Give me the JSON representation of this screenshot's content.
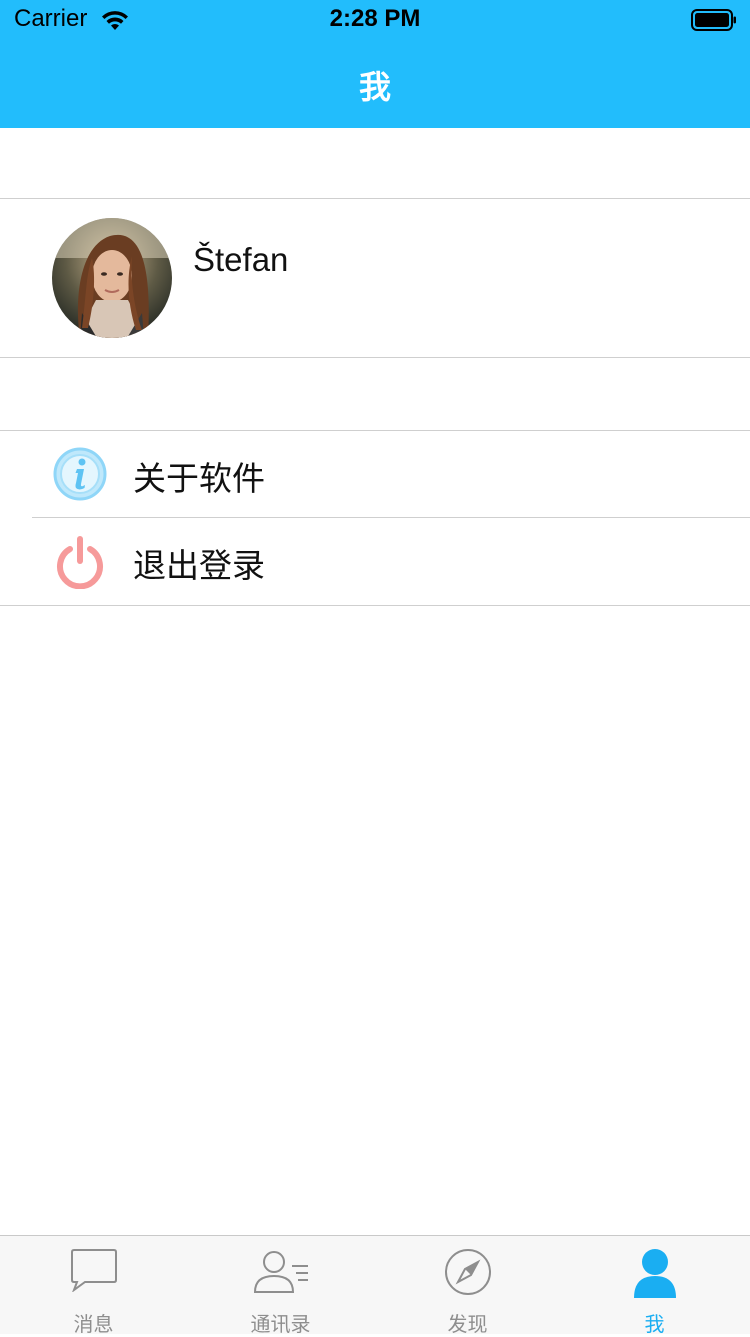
{
  "status_bar": {
    "carrier": "Carrier",
    "time": "2:28 PM",
    "wifi_icon": "wifi-icon",
    "battery_icon": "battery-icon"
  },
  "nav": {
    "title": "我"
  },
  "profile": {
    "name": "Štefan",
    "avatar": "avatar-photo"
  },
  "menu": {
    "items": [
      {
        "label": "关于软件",
        "icon": "info-icon",
        "icon_color": "#8fd6f8"
      },
      {
        "label": "退出登录",
        "icon": "power-icon",
        "icon_color": "#f69a9a"
      }
    ]
  },
  "tabs": [
    {
      "label": "消息",
      "icon": "chat-bubble-icon",
      "active": false
    },
    {
      "label": "通讯录",
      "icon": "contacts-icon",
      "active": false
    },
    {
      "label": "发现",
      "icon": "compass-icon",
      "active": false
    },
    {
      "label": "我",
      "icon": "person-icon",
      "active": true
    }
  ],
  "colors": {
    "accent": "#22bdfc",
    "tab_active": "#1aaef2",
    "tab_inactive": "#8e8e8e",
    "separator": "#cfcfcf"
  }
}
